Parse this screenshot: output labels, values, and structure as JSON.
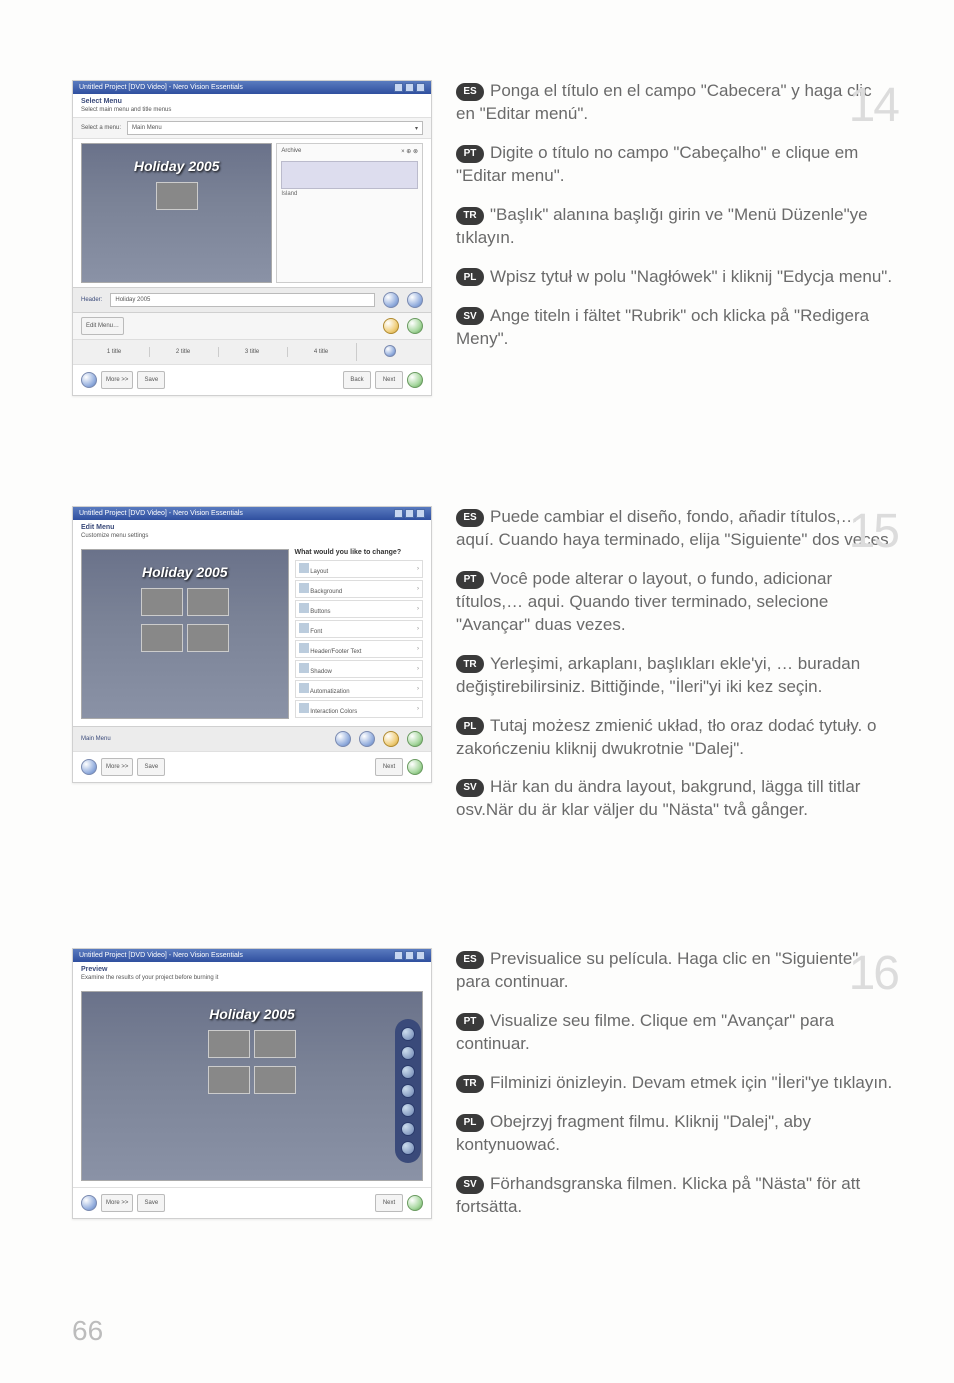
{
  "page_number": "66",
  "thumb_title": "Untitled Project [DVD Video] - Nero Vision Essentials",
  "preview_title": "Holiday 2005",
  "step14": {
    "num": "14",
    "subhead": "Select Menu",
    "subdesc": "Select main menu and title menus",
    "toolbar_label": "Select a menu:",
    "dropdown_value": "Main Menu",
    "archive_label": "Archive",
    "island_label": "Island",
    "bottom_label": "Holiday 2005",
    "edit_menu": "Edit Menu…",
    "timeline": [
      "1 title",
      "2 title",
      "3 title",
      "4 title"
    ],
    "nav_more": "More >>",
    "nav_save": "Save",
    "nav_back": "Back",
    "nav_next": "Next",
    "entries": [
      {
        "lang": "ES",
        "text": "Ponga el título en el campo \"Cabecera\" y haga clic en \"Editar menú\"."
      },
      {
        "lang": "PT",
        "text": "Digite o título no campo \"Cabeçalho\" e clique em \"Editar menu\"."
      },
      {
        "lang": "TR",
        "text": "\"Başlık\" alanına başlığı girin ve \"Menü Düzenle\"ye tıklayın."
      },
      {
        "lang": "PL",
        "text": "Wpisz tytuł w polu \"Nagłówek\" i kliknij \"Edycja menu\"."
      },
      {
        "lang": "SV",
        "text": "Ange titeln i fältet \"Rubrik\" och klicka på \"Redigera Meny\"."
      }
    ]
  },
  "step15": {
    "num": "15",
    "subhead": "Edit Menu",
    "subdesc": "Customize menu settings",
    "side_question": "What would you like to change?",
    "options": [
      "Layout",
      "Background",
      "Buttons",
      "Font",
      "Header/Footer Text",
      "Shadow",
      "Automatization",
      "Interaction Colors"
    ],
    "bottom_label": "Main Menu",
    "entries": [
      {
        "lang": "ES",
        "text": "Puede cambiar el diseño, fondo, añadir títulos,… aquí. Cuando haya terminado, elija \"Siguiente\" dos veces."
      },
      {
        "lang": "PT",
        "text": "Você pode alterar o layout, o fundo, adicionar títulos,… aqui. Quando tiver terminado, selecione \"Avançar\" duas vezes."
      },
      {
        "lang": "TR",
        "text": "Yerleşimi, arkaplanı, başlıkları ekle'yi, … buradan değiştirebilirsiniz. Bittiğinde, \"İleri\"yi iki kez seçin."
      },
      {
        "lang": "PL",
        "text": "Tutaj możesz zmienić układ, tło oraz dodać tytuły. o zakończeniu kliknij dwukrotnie \"Dalej\"."
      },
      {
        "lang": "SV",
        "text": "Här kan du ändra layout, bakgrund, lägga till titlar osv.När du är klar väljer du \"Nästa\" två gånger."
      }
    ]
  },
  "step16": {
    "num": "16",
    "subhead": "Preview",
    "subdesc": "Examine the results of your project before burning it",
    "entries": [
      {
        "lang": "ES",
        "text": "Previsualice su película. Haga clic en \"Siguiente\" para continuar."
      },
      {
        "lang": "PT",
        "text": "Visualize seu filme. Clique em \"Avançar\" para continuar."
      },
      {
        "lang": "TR",
        "text": "Filminizi önizleyin. Devam etmek için \"İleri\"ye tıklayın."
      },
      {
        "lang": "PL",
        "text": "Obejrzyj fragment filmu. Kliknij \"Dalej\", aby kontynuować."
      },
      {
        "lang": "SV",
        "text": "Förhandsgranska filmen. Klicka på \"Nästa\" för att fortsätta."
      }
    ]
  }
}
